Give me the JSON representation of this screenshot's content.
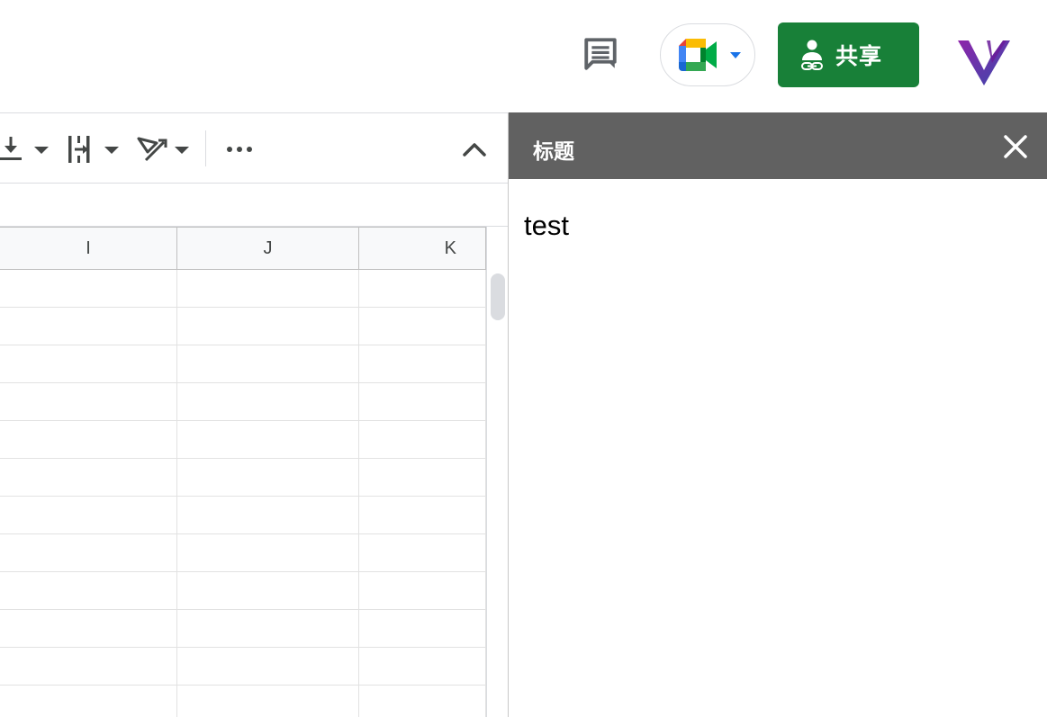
{
  "header": {
    "share_label": "共享",
    "comments_icon": "comment-icon",
    "meet_icon": "google-meet-icon",
    "logo_icon": "v-logo-icon"
  },
  "toolbar": {
    "icons": [
      "vertical-align-icon",
      "text-wrap-icon",
      "text-rotation-icon",
      "more-options-icon",
      "collapse-chevron-icon"
    ]
  },
  "sheet": {
    "columns": [
      "I",
      "J",
      "K"
    ],
    "row_count": 12
  },
  "side_panel": {
    "title": "标题",
    "body_text": "test"
  },
  "colors": {
    "share_green": "#188038",
    "panel_header": "#616161"
  }
}
